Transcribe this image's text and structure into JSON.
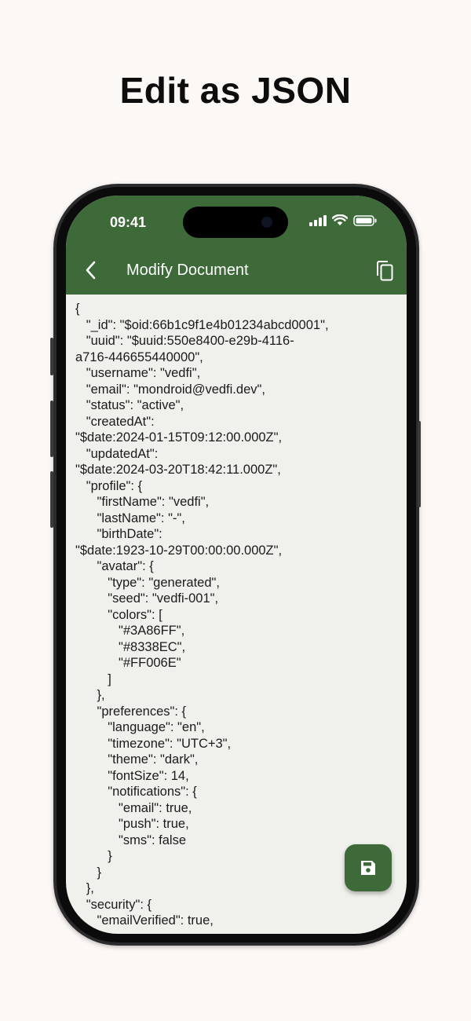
{
  "headline": "Edit as JSON",
  "status_bar": {
    "time": "09:41"
  },
  "app_bar": {
    "title": "Modify Document",
    "back_icon": "chevron-left-icon",
    "copy_icon": "copy-icon"
  },
  "editor": {
    "lines": [
      "{",
      "   \"_id\": \"$oid:66b1c9f1e4b01234abcd0001\",",
      "   \"uuid\": \"$uuid:550e8400-e29b-4116-",
      "a716-446655440000\",",
      "   \"username\": \"vedfi\",",
      "   \"email\": \"mondroid@vedfi.dev\",",
      "   \"status\": \"active\",",
      "   \"createdAt\":",
      "\"$date:2024-01-15T09:12:00.000Z\",",
      "   \"updatedAt\":",
      "\"$date:2024-03-20T18:42:11.000Z\",",
      "   \"profile\": {",
      "      \"firstName\": \"vedfi\",",
      "      \"lastName\": \"-\",",
      "      \"birthDate\":",
      "\"$date:1923-10-29T00:00:00.000Z\",",
      "      \"avatar\": {",
      "         \"type\": \"generated\",",
      "         \"seed\": \"vedfi-001\",",
      "         \"colors\": [",
      "            \"#3A86FF\",",
      "            \"#8338EC\",",
      "            \"#FF006E\"",
      "         ]",
      "      },",
      "      \"preferences\": {",
      "         \"language\": \"en\",",
      "         \"timezone\": \"UTC+3\",",
      "         \"theme\": \"dark\",",
      "         \"fontSize\": 14,",
      "         \"notifications\": {",
      "            \"email\": true,",
      "            \"push\": true,",
      "            \"sms\": false",
      "         }",
      "      }",
      "   },",
      "   \"security\": {",
      "      \"emailVerified\": true,"
    ]
  },
  "fab": {
    "icon": "save-icon"
  },
  "colors": {
    "accent": "#3e6a3a",
    "background": "#fcf8f6",
    "editor_background": "#f0f1ec"
  }
}
